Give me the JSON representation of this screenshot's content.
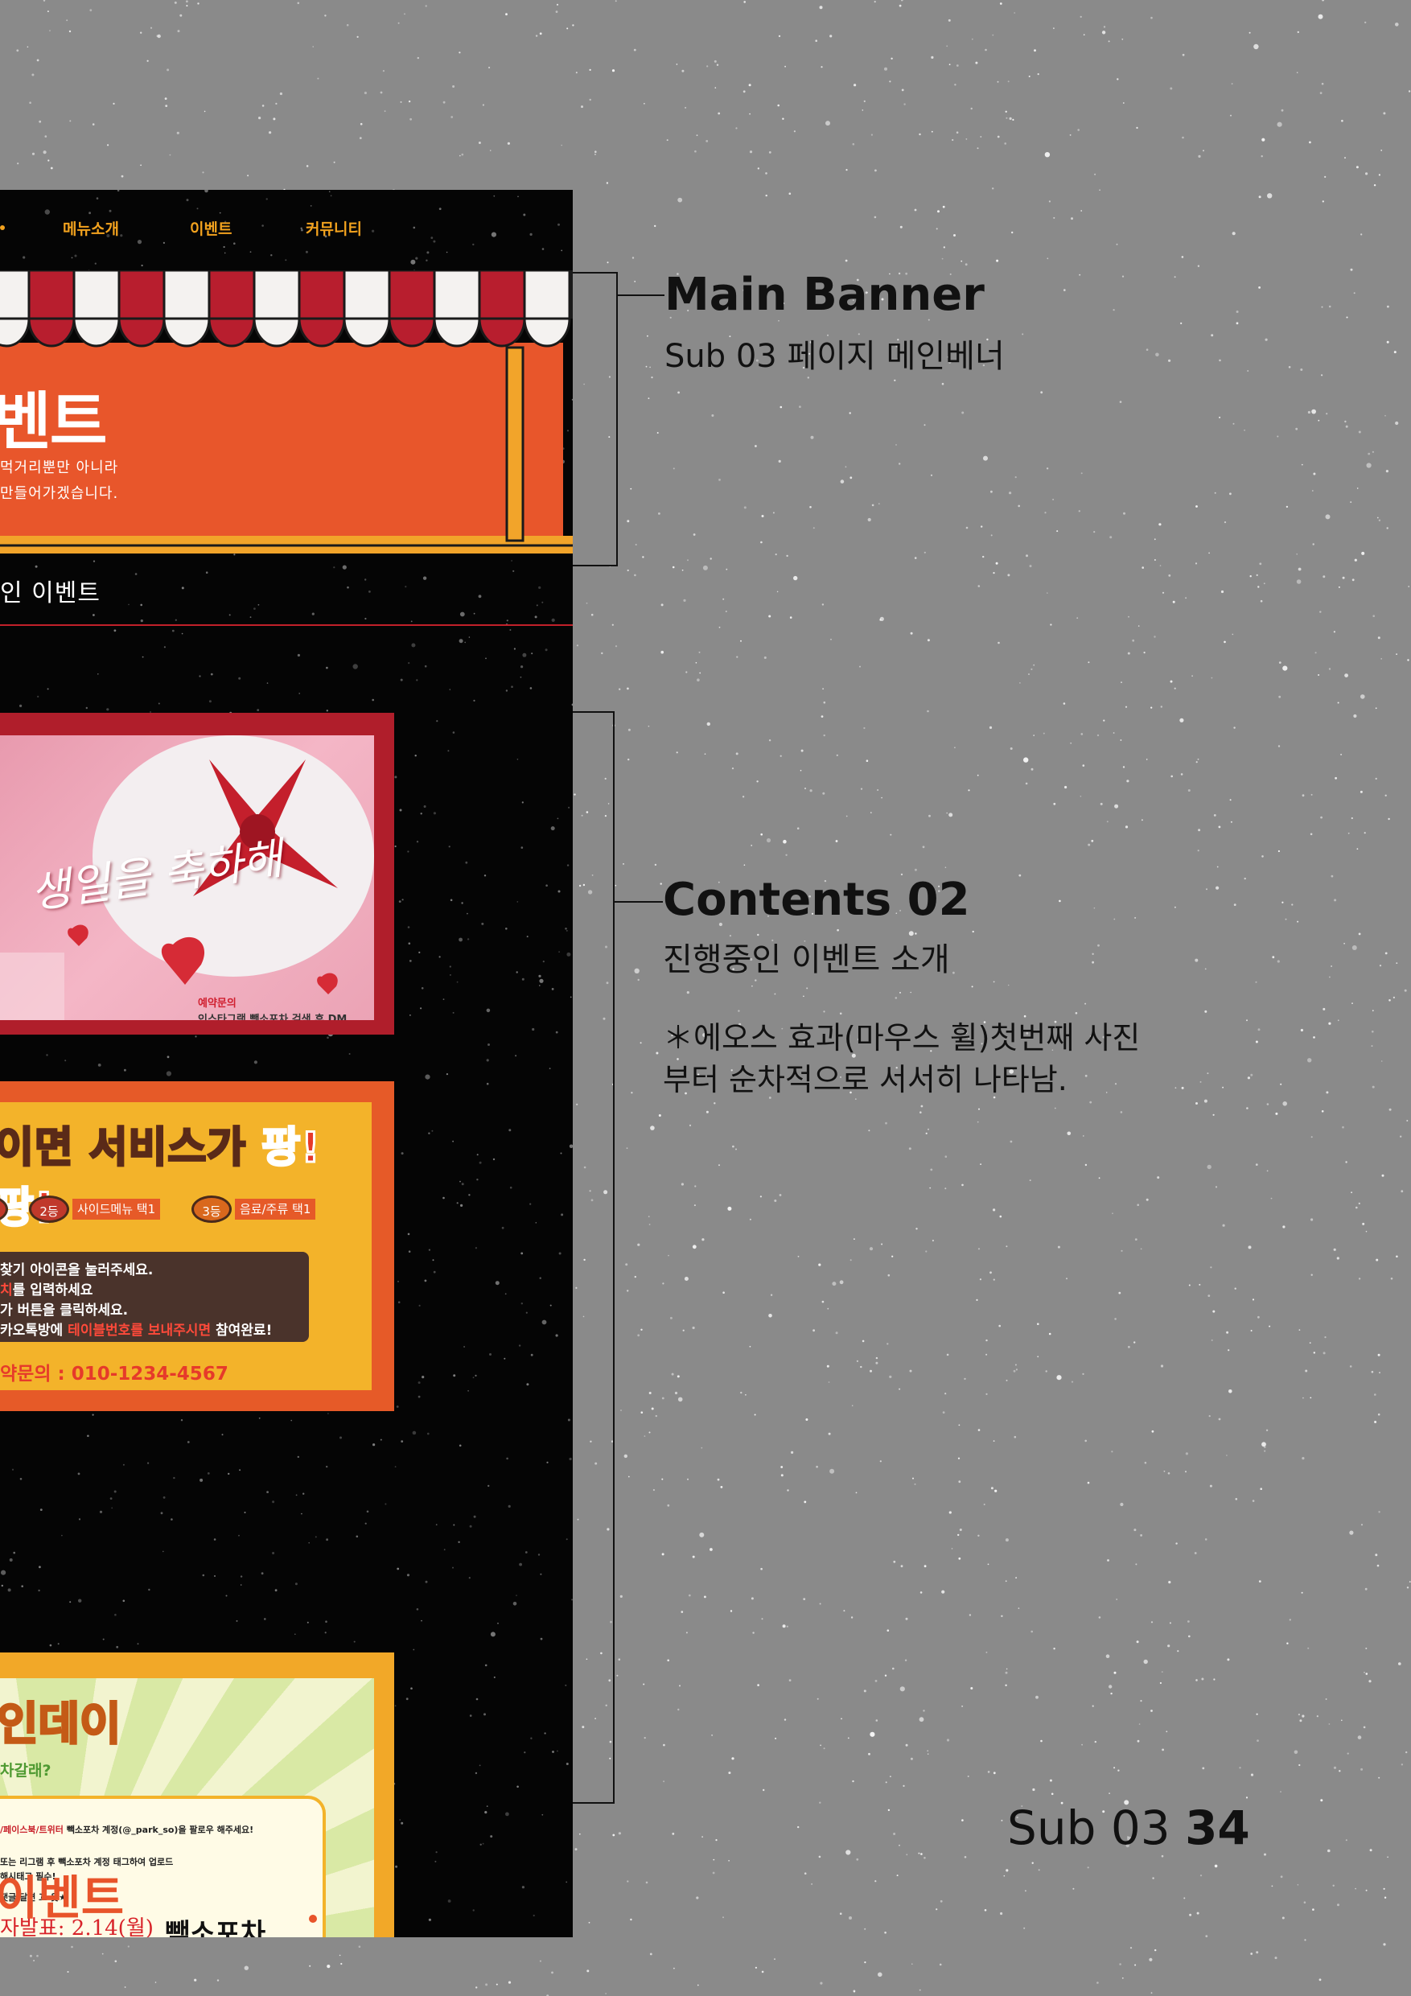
{
  "mockup": {
    "nav": [
      "메뉴소개",
      "이벤트",
      "커뮤니티"
    ],
    "banner": {
      "title": "벤트",
      "text_line1": "먹거리뿐만 아니라",
      "text_line2": "만들어가겠습니다."
    },
    "section_title": "인 이벤트",
    "card1": {
      "script": "생일을 축하해",
      "caption_line1": "예약문의",
      "caption_line2": "인스타그램 빽소포차 검색 후 DM"
    },
    "card2": {
      "headline_part1": "이면 서비스가 ",
      "headline_part2": "팡!팡!",
      "badges": [
        {
          "rank": "2등",
          "label": "사이드메뉴 택1"
        },
        {
          "rank": "3등",
          "label": "음료/주류 택1"
        }
      ],
      "step1": "찾기 아이콘을 눌러주세요.",
      "step2_red": "치",
      "step2": "를 입력하세요",
      "step3": "가 버튼을 클릭하세요.",
      "step4_a": "카오톡방에 ",
      "step4_red": "테이블번호를 보내주시면",
      "step4_b": " 참여완료!",
      "phone": "약문의 : 010-1234-4567"
    },
    "card3": {
      "title": "인데이",
      "subtitle": "차갈래?",
      "line1_red": "/페이스북/트위터",
      "line1": " 빽소포차 계정(@_park_so)을 팔로우 해주세요!",
      "line2": "또는 리그램 후 빽소포차 계정 태그하여 업로드",
      "line3": "해시태그 필수!",
      "line4": "댓글 달면 끄-읏★",
      "date": "자발표: 2.14(월)",
      "logo": "빽소포차"
    },
    "bottom_title": "이벤트"
  },
  "annotations": {
    "main_banner": {
      "title": "Main Banner",
      "subtitle": "Sub 03 페이지 메인베너"
    },
    "contents": {
      "title": "Contents 02",
      "subtitle": "진행중인 이벤트 소개",
      "note_line1": "＊에오스 효과(마우스 휠)첫번째 사진",
      "note_line2": "부터 순차적으로 서서히 나타남."
    }
  },
  "footer": {
    "page_label": "Sub 03",
    "page_number": "34"
  },
  "colors": {
    "background": "#8a8a8a",
    "site_bg": "#050505",
    "accent_orange": "#e8542a",
    "accent_yellow": "#f3b32a",
    "accent_red": "#b01e2b"
  }
}
